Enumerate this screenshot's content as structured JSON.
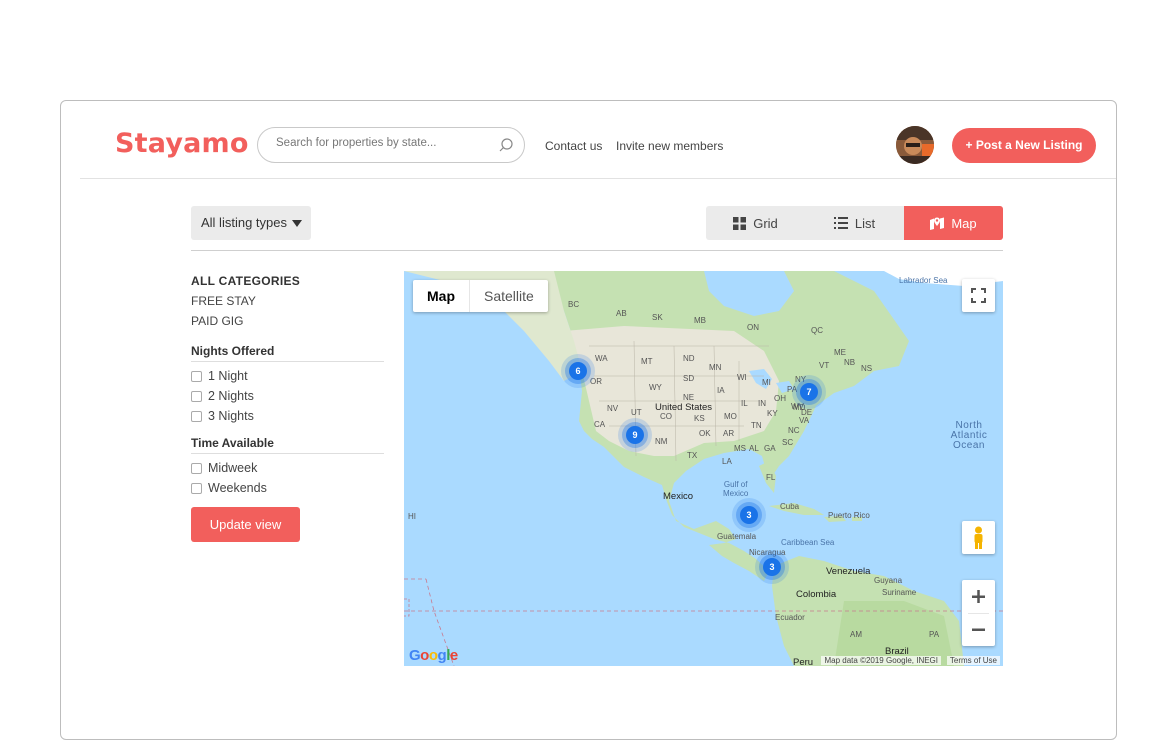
{
  "brand": {
    "logo_text": "Stayamo",
    "accent_color": "#f25f5c"
  },
  "header": {
    "search_placeholder": "Search for properties by state...",
    "nav": [
      "Contact us",
      "Invite new members"
    ],
    "post_button": "+ Post a New Listing"
  },
  "toolbar": {
    "listing_type": "All listing types",
    "views": [
      {
        "label": "Grid",
        "icon": "grid-icon"
      },
      {
        "label": "List",
        "icon": "list-icon"
      },
      {
        "label": "Map",
        "icon": "map-marker-icon",
        "active": true
      }
    ]
  },
  "filters": {
    "categories_title": "ALL CATEGORIES",
    "categories": [
      "FREE STAY",
      "PAID GIG"
    ],
    "nights_title": "Nights Offered",
    "nights": [
      "1 Night",
      "2 Nights",
      "3 Nights"
    ],
    "time_title": "Time Available",
    "times": [
      "Midweek",
      "Weekends"
    ],
    "update_button": "Update view"
  },
  "map": {
    "type_options": [
      "Map",
      "Satellite"
    ],
    "selected_type": "Map",
    "clusters": [
      "6",
      "9",
      "7",
      "3",
      "3"
    ],
    "labels": {
      "labrador": "Labrador Sea",
      "bc": "BC",
      "ab": "AB",
      "sk": "SK",
      "mb": "MB",
      "on": "ON",
      "qc": "QC",
      "nb": "NB",
      "ns": "NS",
      "wa": "WA",
      "or": "OR",
      "mt": "MT",
      "nd": "ND",
      "sd": "SD",
      "wy": "WY",
      "ne": "NE",
      "ia": "IA",
      "mn": "MN",
      "wi": "WI",
      "mi": "MI",
      "nv": "NV",
      "ut": "UT",
      "co": "CO",
      "ks": "KS",
      "mo": "MO",
      "il": "IL",
      "in": "IN",
      "oh": "OH",
      "ca": "CA",
      "az": "AZ",
      "nm": "NM",
      "ok": "OK",
      "ar": "AR",
      "tn": "TN",
      "ky": "KY",
      "va": "VA",
      "pa": "PA",
      "ny": "NY",
      "vt": "VT",
      "me": "ME",
      "md": "MD",
      "de": "DE",
      "nc": "NC",
      "sc": "SC",
      "ga": "GA",
      "al": "AL",
      "ms": "MS",
      "la": "LA",
      "tx": "TX",
      "fl": "FL",
      "wv": "WV",
      "us": "United States",
      "ocean": [
        "North",
        "Atlantic",
        "Ocean"
      ],
      "gulf": [
        "Gulf of",
        "Mexico"
      ],
      "mexico": "Mexico",
      "cuba": "Cuba",
      "puerto_rico": "Puerto Rico",
      "guatemala": "Guatemala",
      "nicaragua": "Nicaragua",
      "caribbean": "Caribbean Sea",
      "venezuela": "Venezuela",
      "guyana": "Guyana",
      "suriname": "Suriname",
      "colombia": "Colombia",
      "ecuador": "Ecuador",
      "peru": "Peru",
      "brazil": "Brazil",
      "am": "AM",
      "pa2": "PA",
      "hi": "HI"
    },
    "attribution": "Map data ©2019 Google, INEGI",
    "terms": "Terms of Use",
    "google_logo": "Google"
  }
}
